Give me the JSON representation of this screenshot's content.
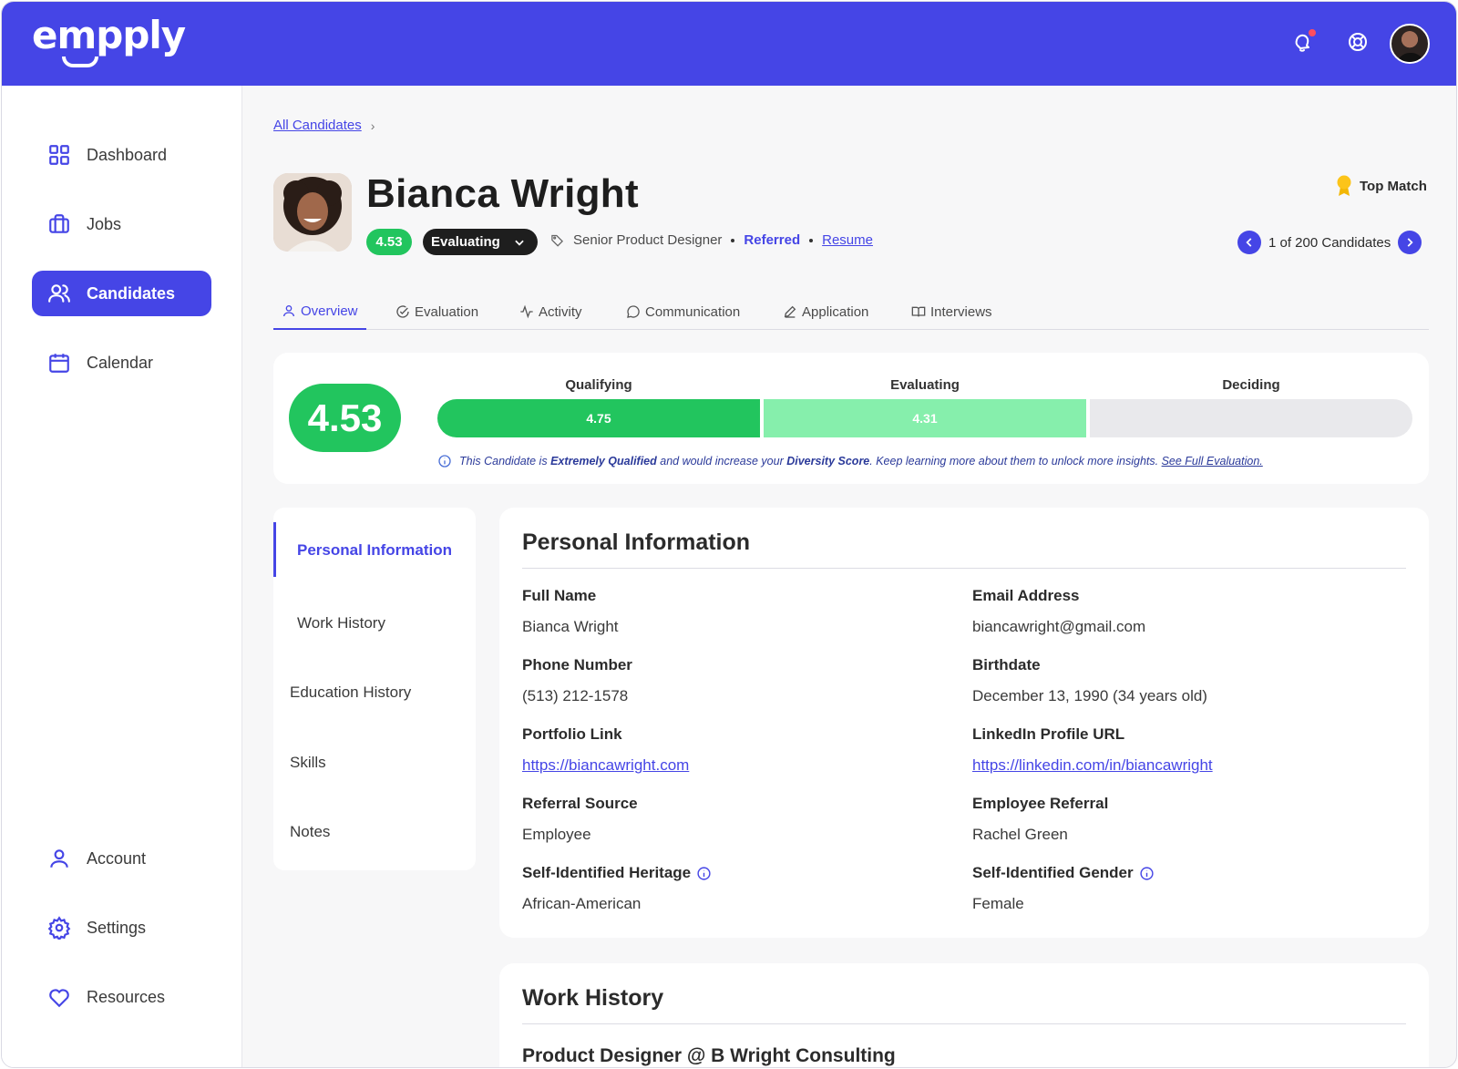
{
  "app": {
    "logo_text": "empply",
    "accent_color": "#4545e6",
    "success_color": "#22c55e"
  },
  "topbar": {
    "icons": [
      "notification-icon",
      "help-icon"
    ],
    "avatar": "user-avatar"
  },
  "sidebar": {
    "items": [
      {
        "label": "Dashboard",
        "icon": "dashboard-grid-icon"
      },
      {
        "label": "Jobs",
        "icon": "briefcase-icon"
      },
      {
        "label": "Candidates",
        "icon": "users-icon",
        "active": true
      },
      {
        "label": "Calendar",
        "icon": "calendar-icon"
      },
      {
        "label": "Account",
        "icon": "user-icon"
      },
      {
        "label": "Settings",
        "icon": "gear-icon"
      },
      {
        "label": "Resources",
        "icon": "heart-icon"
      }
    ]
  },
  "breadcrumb": {
    "link": "All Candidates",
    "separator": "›"
  },
  "candidate": {
    "name": "Bianca Wright",
    "score": "4.53",
    "status": "Evaluating",
    "title": "Senior Product Designer",
    "source_tag": "Referred",
    "resume_link": "Resume",
    "top_match": "Top Match",
    "pager_text": "1 of 200 Candidates"
  },
  "tabs": [
    {
      "label": "Overview",
      "icon": "user-icon",
      "active": true
    },
    {
      "label": "Evaluation",
      "icon": "check-circle-icon"
    },
    {
      "label": "Activity",
      "icon": "activity-icon"
    },
    {
      "label": "Communication",
      "icon": "chat-bubble-icon"
    },
    {
      "label": "Application",
      "icon": "pencil-icon"
    },
    {
      "label": "Interviews",
      "icon": "book-open-icon"
    }
  ],
  "score_card": {
    "overall": "4.53",
    "stages": [
      {
        "label": "Qualifying",
        "value": "4.75",
        "color": "#22c55e"
      },
      {
        "label": "Evaluating",
        "value": "4.31",
        "color": "#86efac"
      },
      {
        "label": "Deciding",
        "value": "",
        "color": "#e9e9ec"
      }
    ],
    "info": {
      "part1": "This Candidate is ",
      "bold1": "Extremely Qualified",
      "part2": " and would increase your ",
      "bold2": "Diversity Score",
      "part3": ". Keep learning more about them to unlock more insights. ",
      "link": "See Full Evaluation."
    }
  },
  "section_nav": {
    "items": [
      "Personal Information",
      "Work History",
      "Education History",
      "Skills",
      "Notes"
    ]
  },
  "personal_info": {
    "title": "Personal Information",
    "fields": [
      {
        "label": "Full Name",
        "value": "Bianca Wright"
      },
      {
        "label": "Email Address",
        "value": "biancawright@gmail.com"
      },
      {
        "label": "Phone Number",
        "value": "(513) 212-1578"
      },
      {
        "label": "Birthdate",
        "value": "December 13, 1990 (34 years old)"
      },
      {
        "label": "Portfolio Link",
        "value": "https://biancawright.com"
      },
      {
        "label": "LinkedIn Profile URL",
        "value": "https://linkedin.com/in/biancawright"
      },
      {
        "label": "Referral Source",
        "value": "Employee"
      },
      {
        "label": "Employee Referral",
        "value": "Rachel Green"
      },
      {
        "label": "Self-Identified Heritage",
        "value": "African-American"
      },
      {
        "label": "Self-Identified Gender",
        "value": "Female"
      }
    ]
  },
  "work_history": {
    "title": "Work History",
    "first_role": "Product Designer @ B Wright Consulting"
  }
}
